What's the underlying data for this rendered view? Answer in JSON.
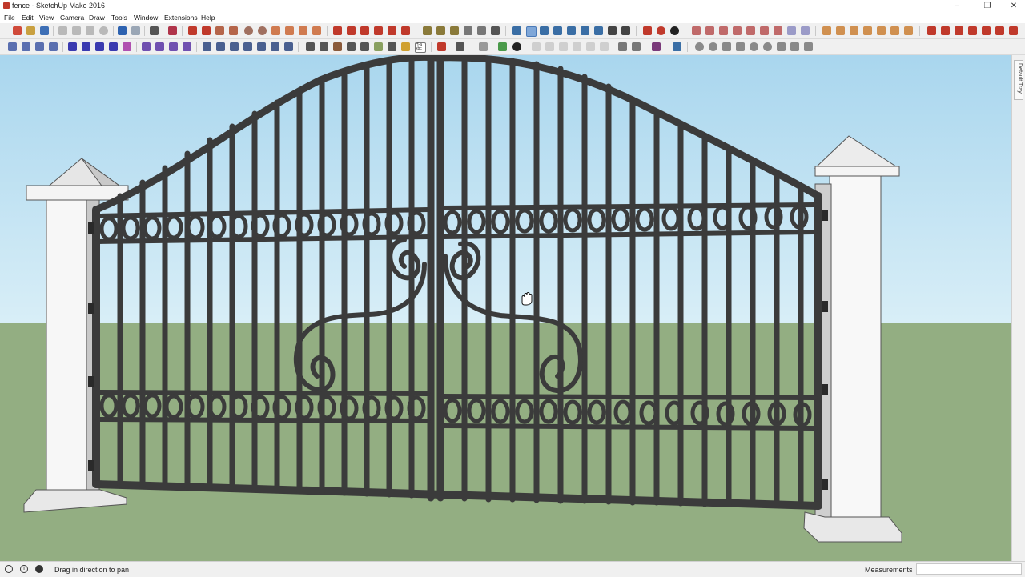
{
  "window": {
    "title": "fence - SketchUp Make 2016",
    "controls": [
      "minimize-icon",
      "restore-icon",
      "close-icon"
    ]
  },
  "menu": {
    "items": [
      "File",
      "Edit",
      "View",
      "Camera",
      "Draw",
      "Tools",
      "Window",
      "Extensions",
      "Help"
    ]
  },
  "toolbar": {
    "text_tool_label": "H-a xbc"
  },
  "tray": {
    "label": "Default Tray"
  },
  "status": {
    "icons": [
      "geo-location-icon",
      "credits-icon",
      "user-icon"
    ],
    "message": "Drag in direction to pan",
    "measurements_label": "Measurements",
    "measurements_value": ""
  },
  "colors": {
    "sky": "#c5e4f4",
    "ground": "#93ae82",
    "iron": "#3b3b3b",
    "pillar": "#f7f7f7"
  }
}
